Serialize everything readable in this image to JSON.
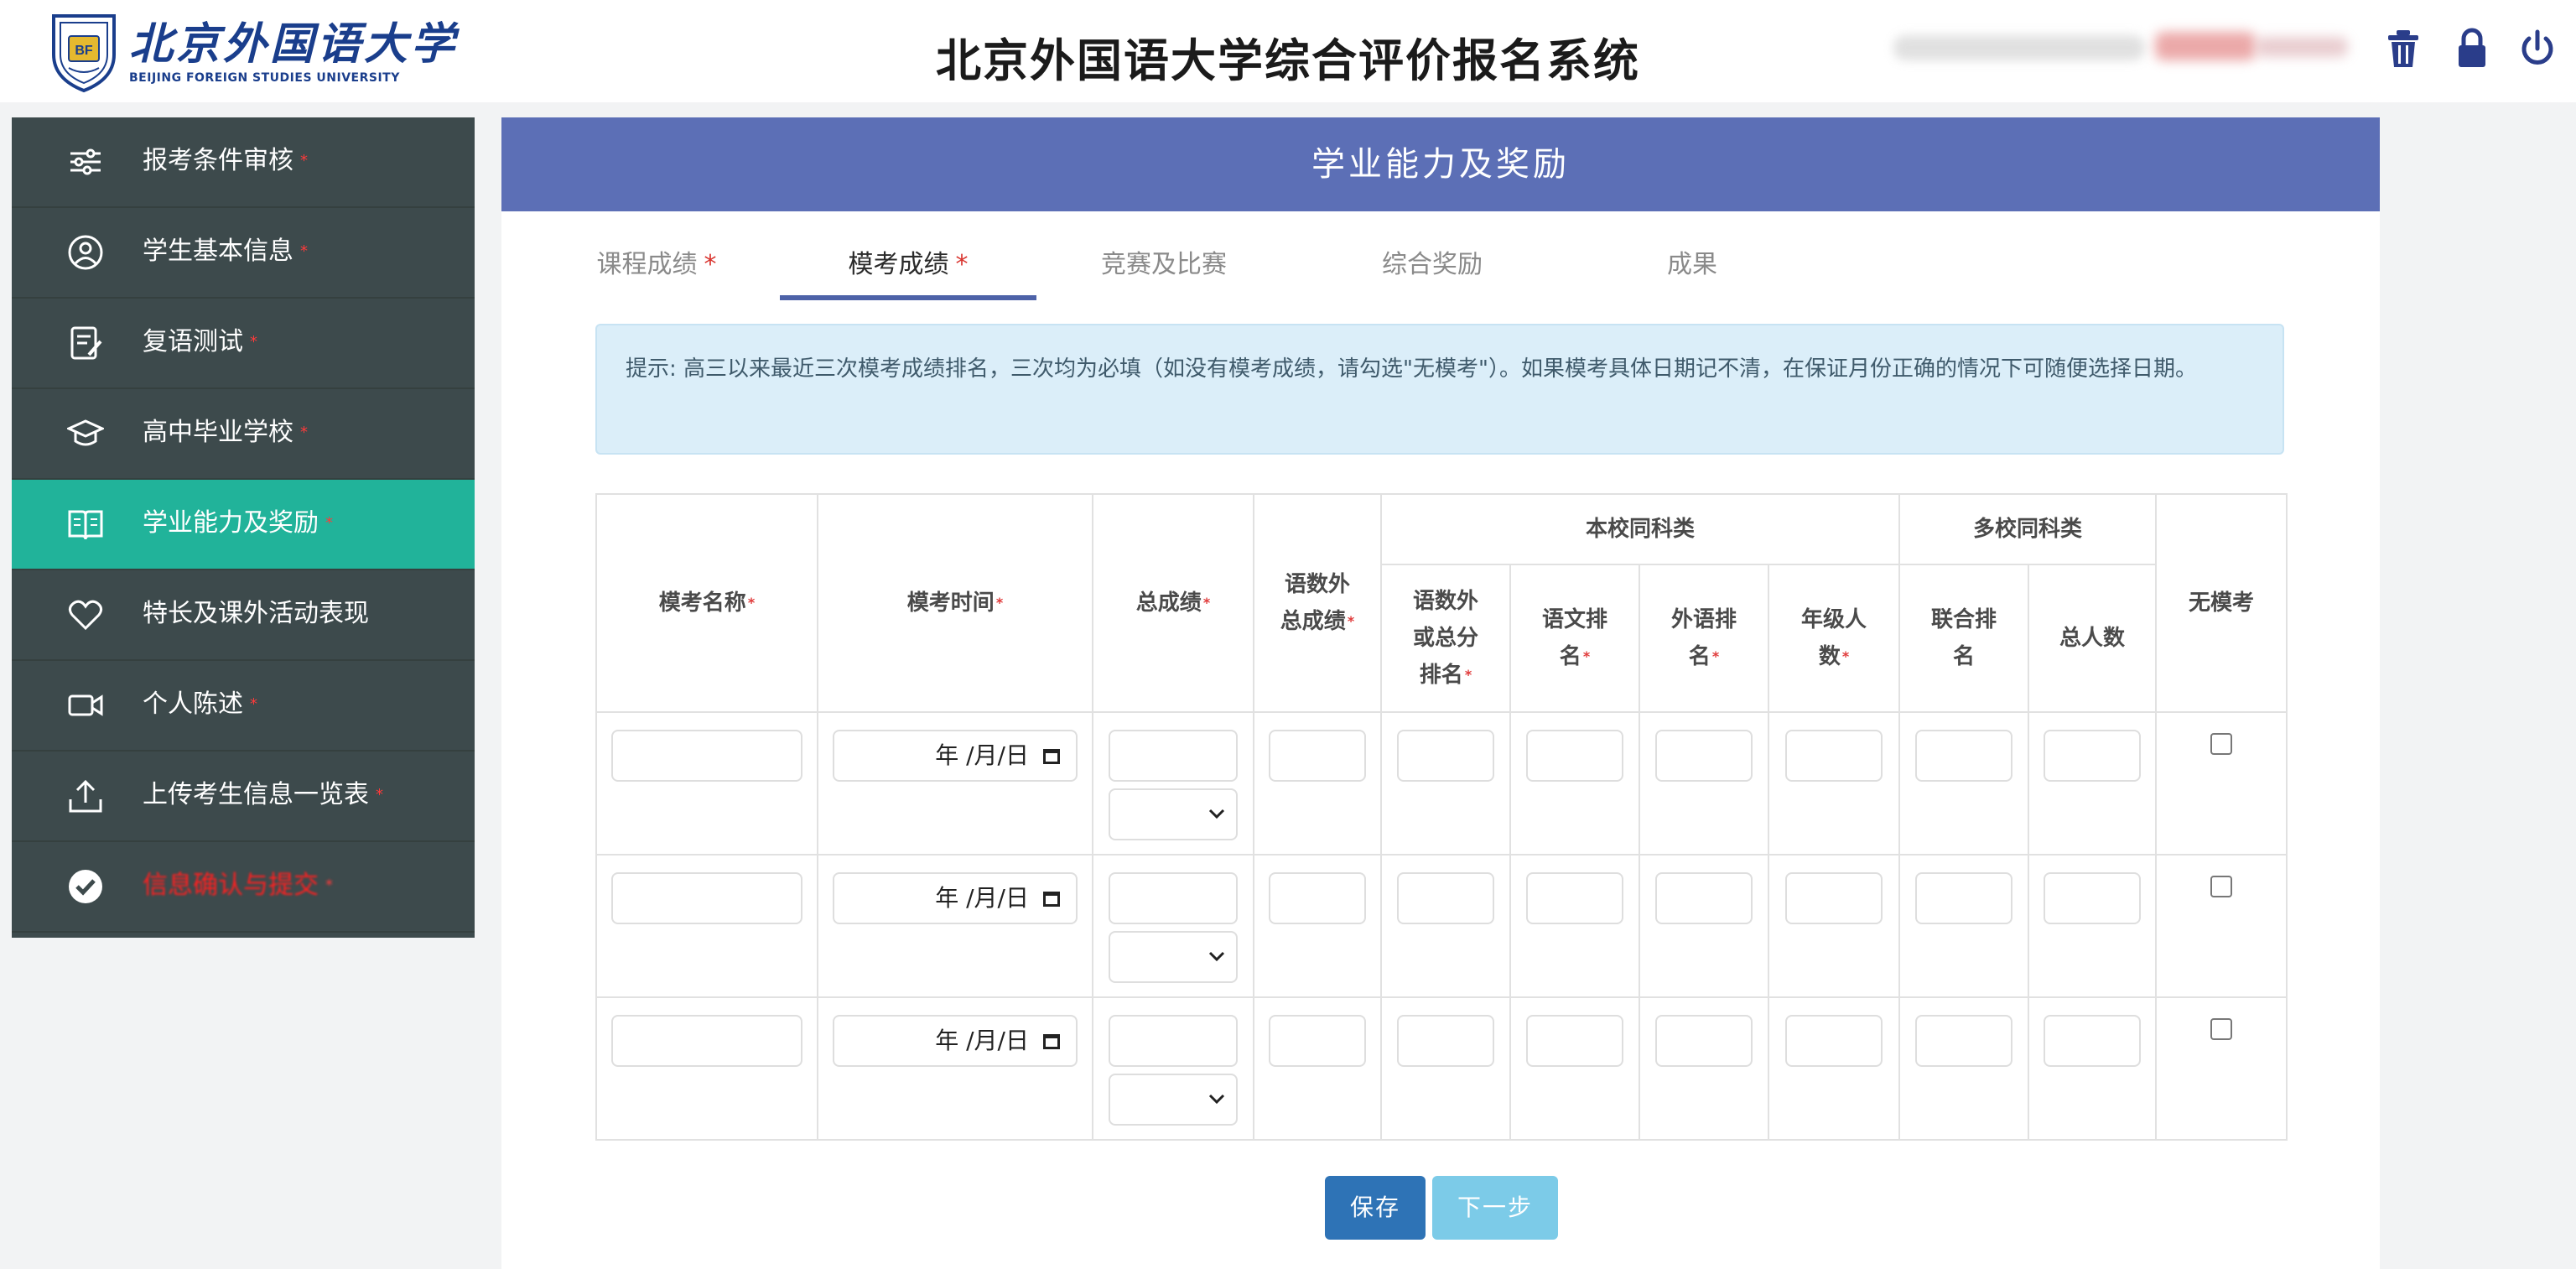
{
  "header": {
    "university_name_cn": "北京外国语大学",
    "university_name_en": "BEIJING FOREIGN STUDIES UNIVERSITY",
    "app_title": "北京外国语大学综合评价报名系统",
    "icons": [
      "trash-icon",
      "lock-icon",
      "power-icon"
    ]
  },
  "sidebar": {
    "items": [
      {
        "label": "报考条件审核",
        "required": "*",
        "icon": "sliders-icon"
      },
      {
        "label": "学生基本信息",
        "required": "*",
        "icon": "user-circle-icon"
      },
      {
        "label": "复语测试",
        "required": "*",
        "icon": "edit-document-icon"
      },
      {
        "label": "高中毕业学校",
        "required": "*",
        "icon": "graduation-cap-icon"
      },
      {
        "label": "学业能力及奖励",
        "required": "*",
        "icon": "open-book-icon"
      },
      {
        "label": "特长及课外活动表现",
        "required": "",
        "icon": "heart-icon"
      },
      {
        "label": "个人陈述",
        "required": "*",
        "icon": "video-icon"
      },
      {
        "label": "上传考生信息一览表",
        "required": "*",
        "icon": "upload-icon"
      },
      {
        "label": "信息确认与提交",
        "required": "*",
        "icon": "check-circle-icon"
      }
    ],
    "active_index": 4
  },
  "main": {
    "title": "学业能力及奖励",
    "tabs": [
      {
        "label": "课程成绩",
        "required": "*"
      },
      {
        "label": "模考成绩",
        "required": "*"
      },
      {
        "label": "竞赛及比赛",
        "required": ""
      },
      {
        "label": "综合奖励",
        "required": ""
      },
      {
        "label": "成果",
        "required": ""
      }
    ],
    "active_tab": 1,
    "notice": "提示: 高三以来最近三次模考成绩排名，三次均为必填（如没有模考成绩，请勾选\"无模考\"）。如果模考具体日期记不清，在保证月份正确的情况下可随便选择日期。"
  },
  "table": {
    "group_headers": {
      "local": "本校同科类",
      "multi": "多校同科类"
    },
    "columns": {
      "exam_name": "模考名称",
      "exam_time": "模考时间",
      "total_score": "总成绩",
      "non_foreign_total": "语数外总成绩",
      "local_rank_line1": "语数外",
      "local_rank_line2": "或总分",
      "local_rank_line3": "排名",
      "chinese_rank_line1": "语文排",
      "chinese_rank_line2": "名",
      "foreign_rank_line1": "外语排",
      "foreign_rank_line2": "名",
      "grade_count_line1": "年级人",
      "grade_count_line2": "数",
      "joint_rank_line1": "联合排",
      "joint_rank_line2": "名",
      "total_count": "总人数",
      "no_exam": "无模考",
      "nonforeign_line1": "语数外",
      "nonforeign_line2": "总成绩"
    },
    "date_placeholder": "年 /月/日",
    "rows": 3
  },
  "buttons": {
    "save": "保存",
    "next": "下一步"
  },
  "colors": {
    "sidebar_bg": "#3d4a4c",
    "sidebar_active": "#21b39a",
    "panel_title_bg": "#5c6fb6",
    "save_button": "#2e73b6",
    "next_button": "#7ccbe8"
  }
}
